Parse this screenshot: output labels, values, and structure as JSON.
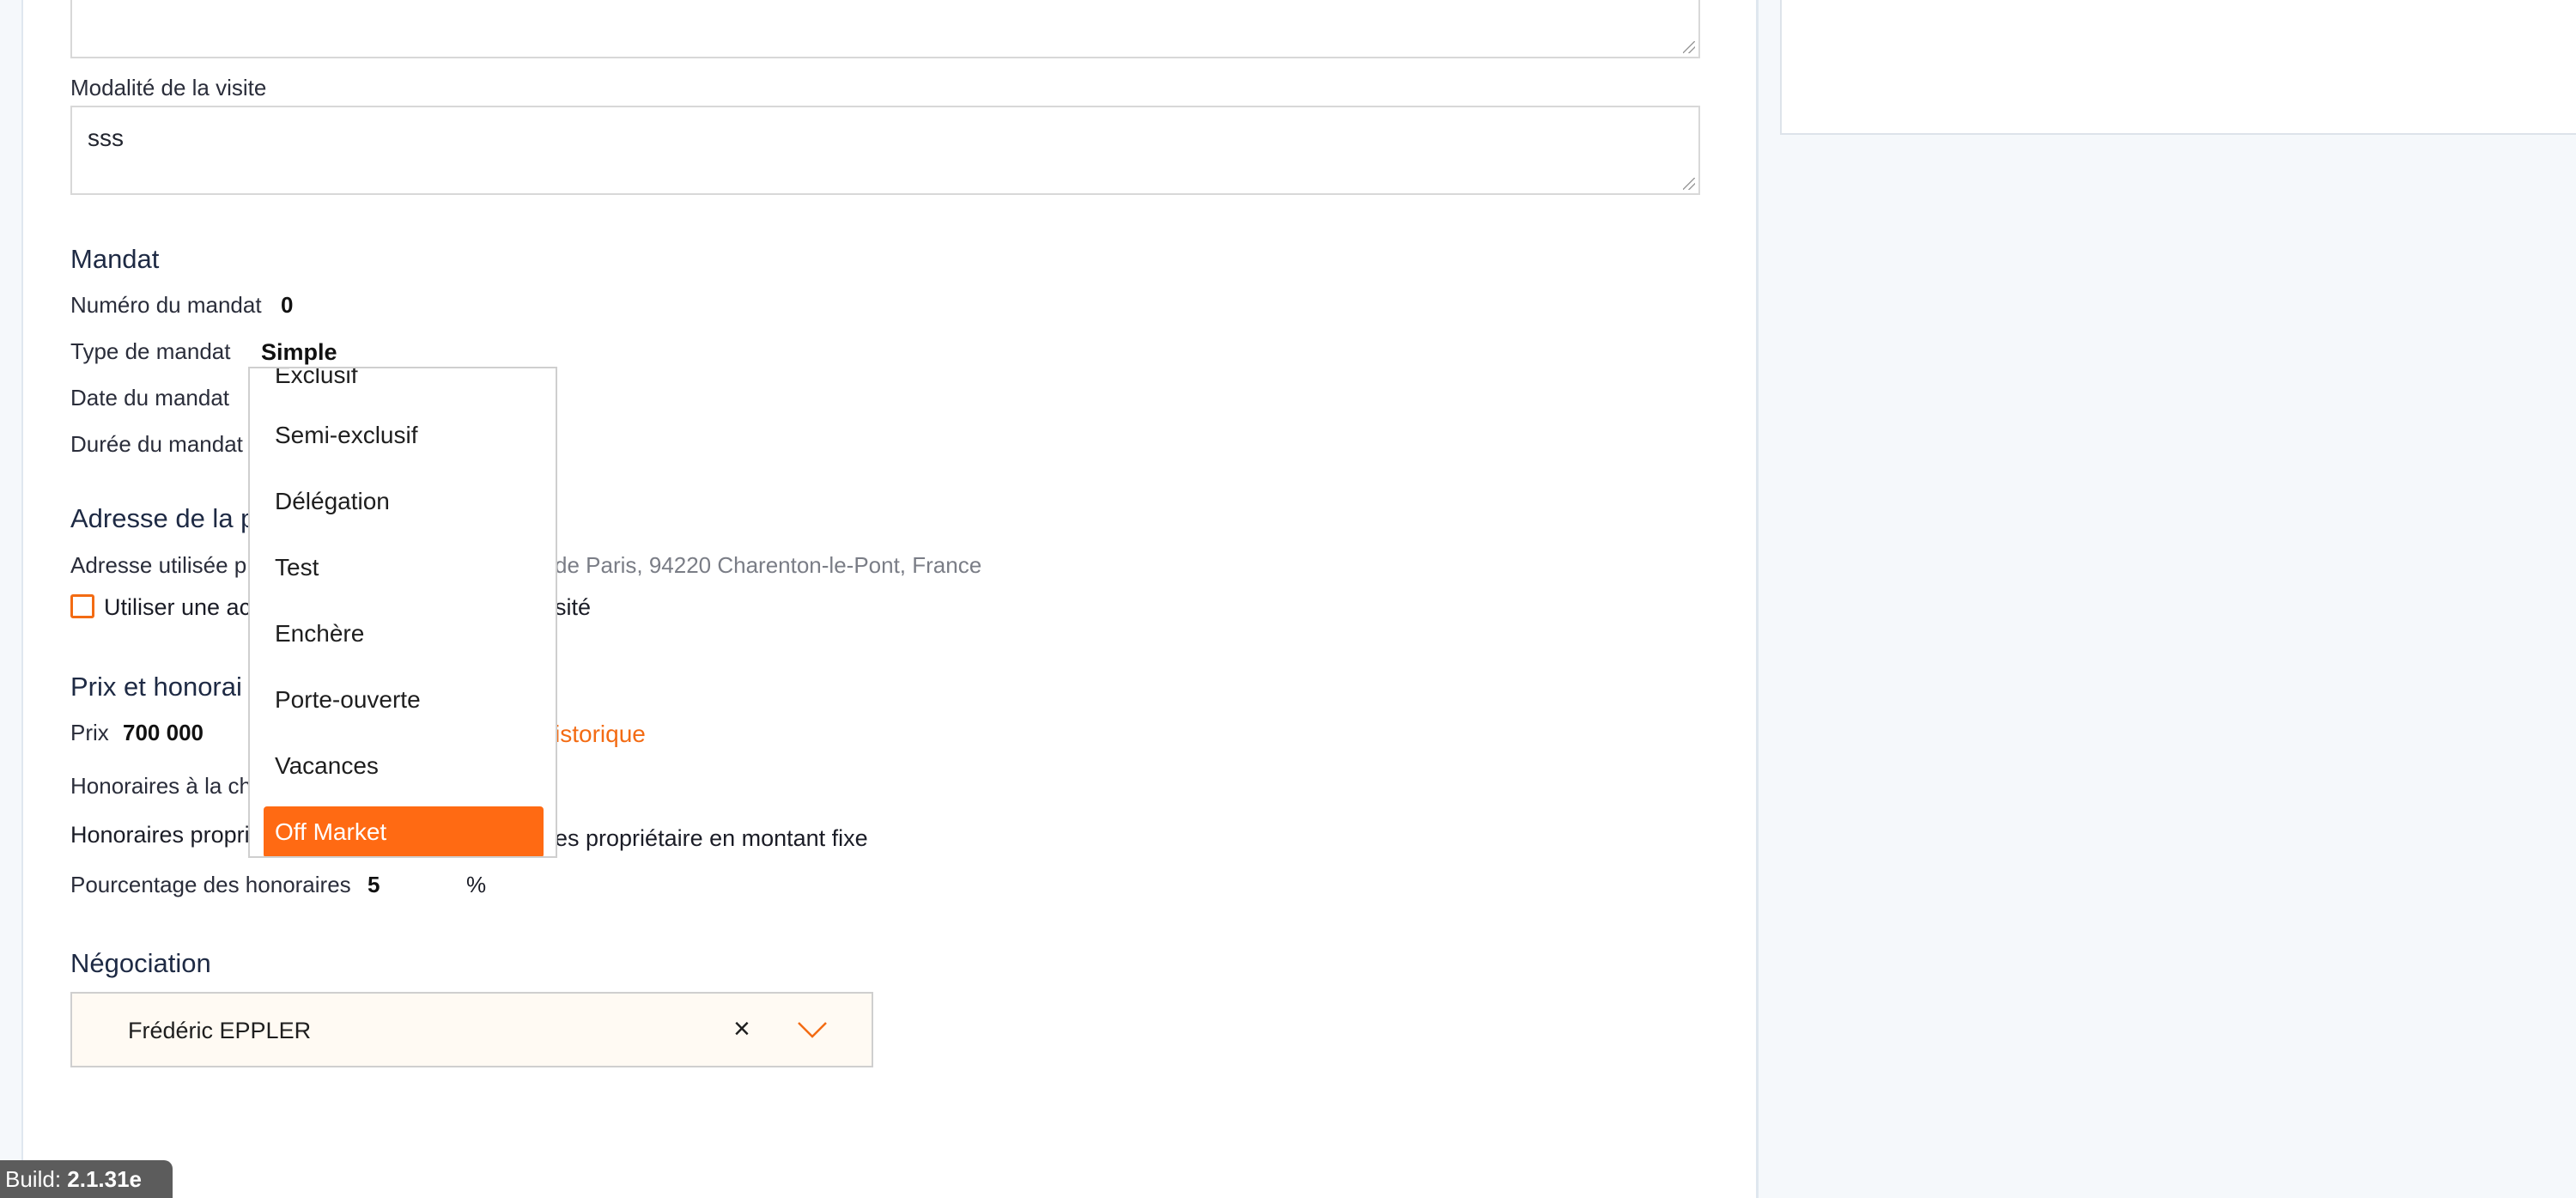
{
  "visit": {
    "modality_label": "Modalité de la visite",
    "modality_value": "sss"
  },
  "mandat": {
    "section_title": "Mandat",
    "number_label": "Numéro du mandat",
    "number_value": "0",
    "type_label": "Type de mandat",
    "type_value": "Simple",
    "date_label": "Date du mandat",
    "duration_label": "Durée du mandat"
  },
  "type_dropdown": {
    "options": [
      "Exclusif",
      "Semi-exclusif",
      "Délégation",
      "Test",
      "Enchère",
      "Porte-ouverte",
      "Vacances",
      "Off Market"
    ],
    "selected": "Off Market"
  },
  "address": {
    "section_title_visible": "Adresse de la p",
    "used_label_visible": "Adresse utilisée p",
    "used_value_visible": "de Paris, 94220 Charenton-le-Pont, France",
    "checkbox_label_left": "Utiliser une ac",
    "checkbox_label_right": "sité"
  },
  "price": {
    "section_title_visible": "Prix et honorai",
    "price_label": "Prix",
    "price_value": "700 000",
    "history_link_visible": "istorique",
    "fees_charge_label_visible": "Honoraires à la ch",
    "fees_owner_label_visible": "Honoraires propri",
    "fees_owner_fixed_visible": "es propriétaire en montant fixe",
    "fees_percent_label": "Pourcentage des honoraires",
    "fees_percent_value": "5",
    "percent_symbol": "%"
  },
  "negotiation": {
    "section_title": "Négociation",
    "negotiator": "Frédéric EPPLER",
    "clear_symbol": "×"
  },
  "build": {
    "label": "Build: ",
    "version": "2.1.31e"
  },
  "colors": {
    "accent": "#ff6a13",
    "link": "#f36b13",
    "section_text": "#1e2a44",
    "select_bg": "#fffaf3"
  }
}
